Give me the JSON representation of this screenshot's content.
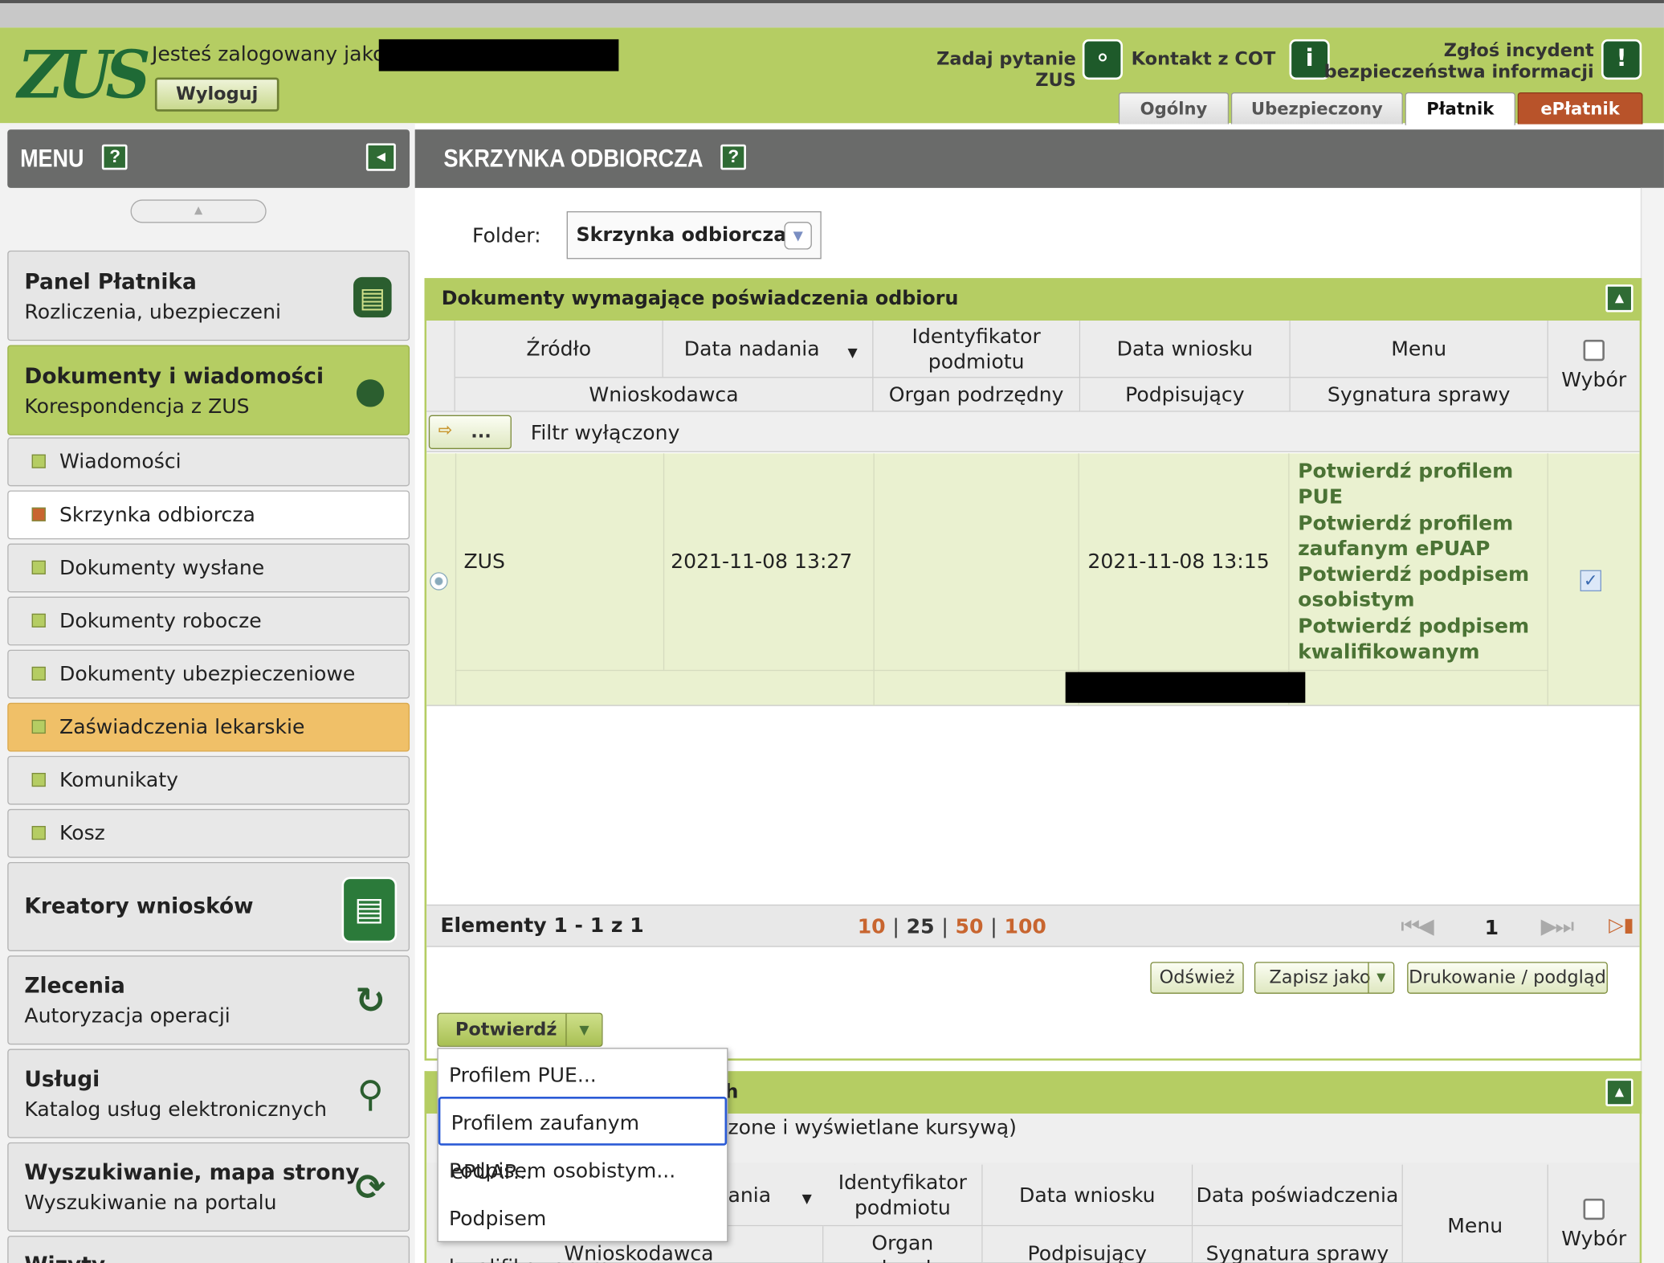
{
  "header": {
    "logged_as": "Jesteś zalogowany jako:",
    "logout": "Wyloguj",
    "ask_zus": "Zadaj pytanie ZUS",
    "contact_cot": "Kontakt z COT",
    "report_line1": "Zgłoś incydent",
    "report_line2": "bezpieczeństwa informacji",
    "tabs": [
      "Ogólny",
      "Ubezpieczony",
      "Płatnik",
      "ePłatnik"
    ]
  },
  "sidebar": {
    "title": "MENU",
    "help": "?",
    "panel_platnika": {
      "title": "Panel Płatnika",
      "sub": "Rozliczenia, ubezpieczeni"
    },
    "dokumenty": {
      "title": "Dokumenty i wiadomości",
      "sub": "Korespondencja z ZUS"
    },
    "items": [
      "Wiadomości",
      "Skrzynka odbiorcza",
      "Dokumenty wysłane",
      "Dokumenty robocze",
      "Dokumenty ubezpieczeniowe (COT)",
      "Zaświadczenia lekarskie",
      "Komunikaty",
      "Kosz"
    ],
    "kreatory": {
      "title": "Kreatory wniosków"
    },
    "zlecenia": {
      "title": "Zlecenia",
      "sub": "Autoryzacja operacji"
    },
    "uslugi": {
      "title": "Usługi",
      "sub": "Katalog usług elektronicznych"
    },
    "wyszukiwanie": {
      "title": "Wyszukiwanie, mapa strony",
      "sub": "Wyszukiwanie na portalu"
    },
    "wizyty": {
      "title": "Wizyty"
    }
  },
  "main": {
    "title": "SKRZYNKA ODBIORCZA",
    "help": "?",
    "folder_label": "Folder:",
    "folder_value": "Skrzynka odbiorcza",
    "panel1": {
      "title": "Dokumenty wymagające poświadczenia odbioru",
      "headers": {
        "zrodlo": "Źródło",
        "data_nadania": "Data nadania",
        "identyfikator1": "Identyfikator",
        "identyfikator2": "podmiotu",
        "data_wniosku": "Data wniosku",
        "menu": "Menu",
        "wybor": "Wybór",
        "wnioskodawca": "Wnioskodawca",
        "organ": "Organ podrzędny",
        "podpisujacy": "Podpisujący",
        "sygnatura": "Sygnatura sprawy"
      },
      "filter_btn": "...",
      "filter_text": "Filtr wyłączony",
      "row": {
        "zrodlo": "ZUS",
        "data_nadania": "2021-11-08 13:27",
        "data_wniosku": "2021-11-08 13:15",
        "actions": [
          "Potwierdź profilem",
          "PUE",
          "Potwierdź profilem",
          "zaufanym ePUAP",
          "Potwierdź podpisem",
          "osobistym",
          "Potwierdź podpisem",
          "kwalifikowanym"
        ]
      },
      "elements": "Elementy 1 - 1 z 1",
      "page_sizes": [
        "10",
        "25",
        "50",
        "100"
      ],
      "separator": "|",
      "page": "1",
      "buttons": {
        "refresh": "Odśwież",
        "save_as": "Zapisz jako",
        "print": "Drukowanie / podgląd"
      },
      "confirm": "Potwierdź"
    },
    "panel2": {
      "title_tail": "h",
      "note_tail": "zone i wyświetlane kursywą)",
      "headers": {
        "nadania": "ania",
        "identyfikator1": "Identyfikator",
        "identyfikator2": "podmiotu",
        "data_wniosku": "Data wniosku",
        "data_poswiadczenia": "Data poświadczenia",
        "menu": "Menu",
        "wybor": "Wybór",
        "wnioskodawca": "Wnioskodawca",
        "organ1": "Organ",
        "organ2": "podrzędny",
        "podpisujacy": "Podpisujący",
        "sygnatura": "Sygnatura sprawy"
      }
    },
    "dropdown": [
      "Profilem PUE...",
      "Profilem zaufanym ePUAP...",
      "Podpisem osobistym...",
      "Podpisem kwalifikowanym..."
    ]
  },
  "colors": {
    "accent_green": "#b5cd63",
    "dark_green": "#2f6b34",
    "highlight_orange": "#f0c068",
    "epłatnik_tab": "#b8532a"
  }
}
